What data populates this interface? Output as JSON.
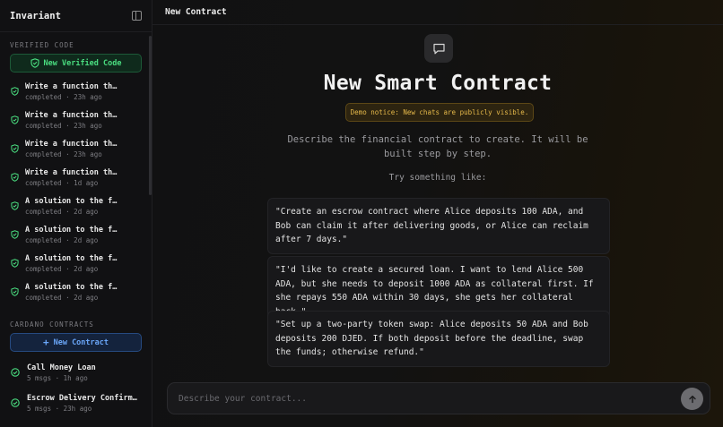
{
  "sidebar": {
    "title": "Invariant",
    "verified_section_label": "VERIFIED CODE",
    "new_verified_label": "New Verified Code",
    "verified_items": [
      {
        "title": "Write a function th…",
        "meta": "completed · 23h ago"
      },
      {
        "title": "Write a function th…",
        "meta": "completed · 23h ago"
      },
      {
        "title": "Write a function th…",
        "meta": "completed · 23h ago"
      },
      {
        "title": "Write a function th…",
        "meta": "completed · 1d ago"
      },
      {
        "title": "A solution to the f…",
        "meta": "completed · 2d ago"
      },
      {
        "title": "A solution to the f…",
        "meta": "completed · 2d ago"
      },
      {
        "title": "A solution to the f…",
        "meta": "completed · 2d ago"
      },
      {
        "title": "A solution to the f…",
        "meta": "completed · 2d ago"
      }
    ],
    "contracts_section_label": "CARDANO CONTRACTS",
    "new_contract_label": "New Contract",
    "contract_items": [
      {
        "title": "Call Money Loan",
        "meta": "5 msgs · 1h ago"
      },
      {
        "title": "Escrow Delivery Confirm…",
        "meta": "5 msgs · 23h ago"
      }
    ]
  },
  "main": {
    "topbar_title": "New Contract",
    "heading": "New Smart Contract",
    "notice": "Demo notice: New chats are publicly visible.",
    "description": "Describe the financial contract to create. It will be built step by step.",
    "try_label": "Try something like:",
    "suggestions": [
      "\"Create an escrow contract where Alice deposits 100 ADA, and Bob can claim it after delivering goods, or Alice can reclaim after 7 days.\"",
      "\"I'd like to create a secured loan. I want to lend Alice 500 ADA, but she needs to deposit 1000 ADA as collateral first. If she repays 550 ADA within 30 days, she gets her collateral back.\"",
      "\"Set up a two-party token swap: Alice deposits 50 ADA and Bob deposits 200 DJED. If both deposit before the deadline, swap the funds; otherwise refund.\""
    ],
    "input_placeholder": "Describe your contract..."
  },
  "icons": {
    "collapse": "sidebar-collapse-icon",
    "verified": "shield-check-icon",
    "contract": "circle-check-icon",
    "chat": "chat-bubble-icon",
    "send": "arrow-up-icon"
  },
  "colors": {
    "green_accent": "#4ade80",
    "blue_accent": "#6aa6f8",
    "notice_text": "#e6b94a"
  }
}
